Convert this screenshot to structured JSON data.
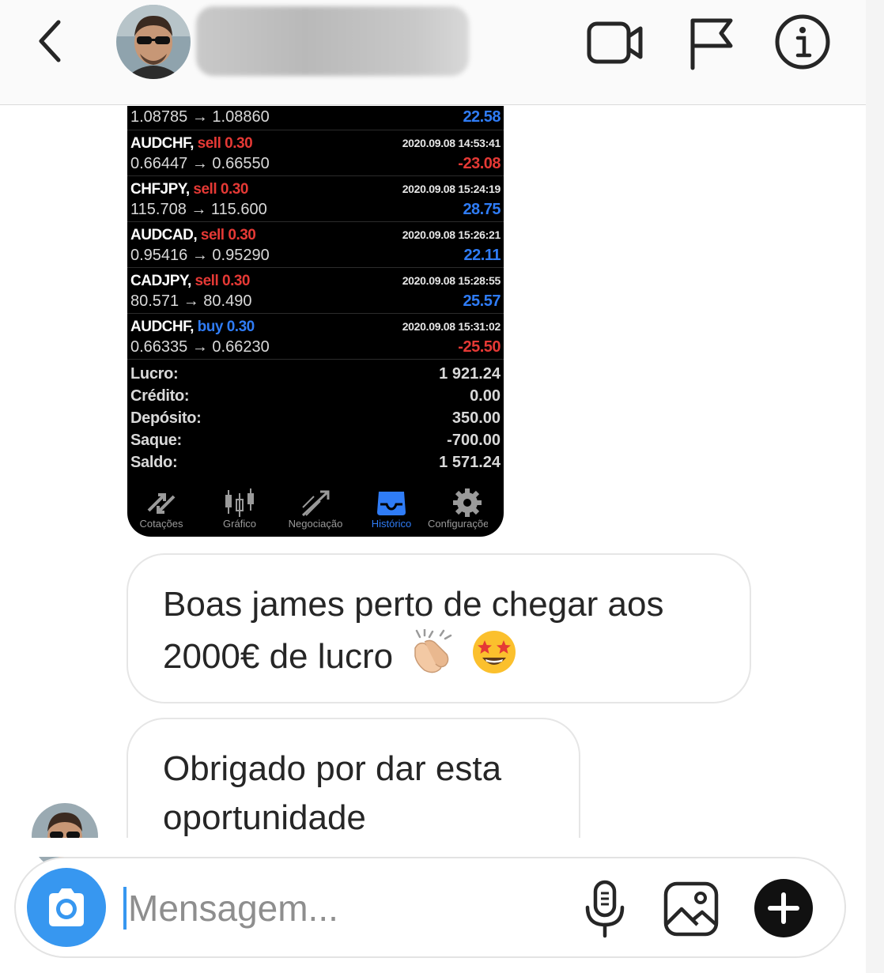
{
  "header": {
    "back_icon": "chevron-left-icon",
    "icons": [
      "video-call-icon",
      "flag-icon",
      "info-icon"
    ]
  },
  "trades": [
    {
      "symbol": "",
      "side": "",
      "volume": "",
      "time": "",
      "price": "1.08785 → 1.08860",
      "profit": "22.58",
      "profit_sign": "pos"
    },
    {
      "symbol": "AUDCHF,",
      "side": "sell",
      "volume": "0.30",
      "time": "2020.09.08 14:53:41",
      "price": "0.66447 → 0.66550",
      "profit": "-23.08",
      "profit_sign": "neg"
    },
    {
      "symbol": "CHFJPY,",
      "side": "sell",
      "volume": "0.30",
      "time": "2020.09.08 15:24:19",
      "price": "115.708 → 115.600",
      "profit": "28.75",
      "profit_sign": "pos"
    },
    {
      "symbol": "AUDCAD,",
      "side": "sell",
      "volume": "0.30",
      "time": "2020.09.08 15:26:21",
      "price": "0.95416 → 0.95290",
      "profit": "22.11",
      "profit_sign": "pos"
    },
    {
      "symbol": "CADJPY,",
      "side": "sell",
      "volume": "0.30",
      "time": "2020.09.08 15:28:55",
      "price": "80.571 → 80.490",
      "profit": "25.57",
      "profit_sign": "pos"
    },
    {
      "symbol": "AUDCHF,",
      "side": "buy",
      "volume": "0.30",
      "time": "2020.09.08 15:31:02",
      "price": "0.66335 → 0.66230",
      "profit": "-25.50",
      "profit_sign": "neg"
    }
  ],
  "summary": [
    {
      "label": "Lucro:",
      "value": "1 921.24"
    },
    {
      "label": "Crédito:",
      "value": "0.00"
    },
    {
      "label": "Depósito:",
      "value": "350.00"
    },
    {
      "label": "Saque:",
      "value": "-700.00"
    },
    {
      "label": "Saldo:",
      "value": "1 571.24"
    }
  ],
  "tabs": [
    {
      "label": "Cotações",
      "icon": "quotes-icon"
    },
    {
      "label": "Gráfico",
      "icon": "candlestick-chart-icon"
    },
    {
      "label": "Negociação",
      "icon": "trade-icon"
    },
    {
      "label": "Histórico",
      "icon": "history-inbox-icon",
      "active": true
    },
    {
      "label": "Configurações",
      "icon": "settings-gear-icon"
    }
  ],
  "messages": {
    "msg1_line1": "Boas james perto de chegar aos",
    "msg1_line2": "2000€ de lucro",
    "msg2_line1": "Obrigado por dar esta",
    "msg2_line2": "oportunidade"
  },
  "composer": {
    "placeholder": "Mensagem..."
  },
  "colors": {
    "accent": "#3797f0",
    "profit_positive": "#2f7cf6",
    "profit_negative": "#e53935"
  }
}
